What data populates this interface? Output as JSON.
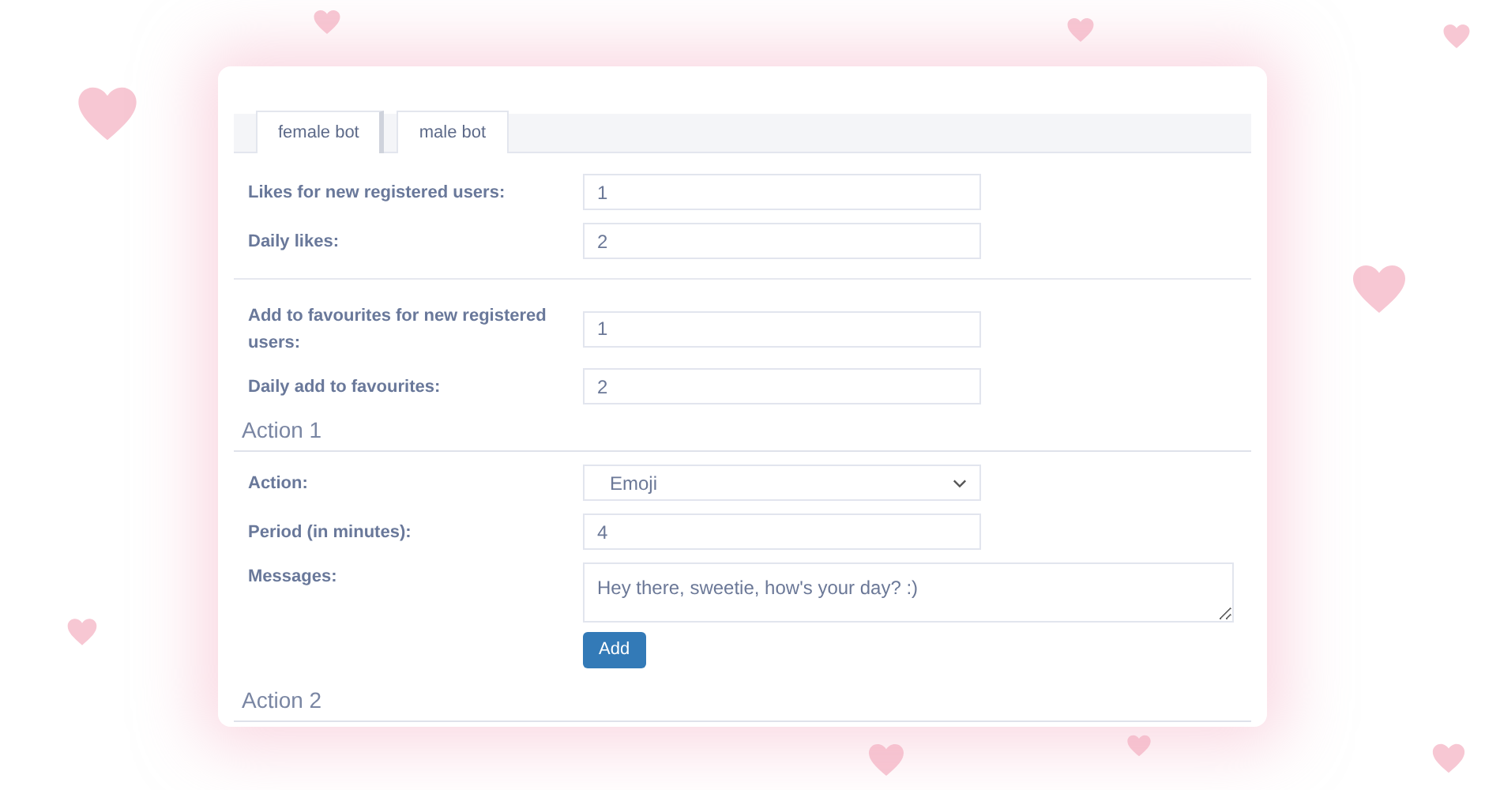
{
  "tabs": [
    {
      "label": "female bot",
      "selected": true
    },
    {
      "label": "male bot",
      "selected": false
    }
  ],
  "groups": [
    {
      "fields": [
        {
          "kind": "input",
          "label": "Likes for new registered users:",
          "value": "1"
        },
        {
          "kind": "input",
          "label": "Daily likes:",
          "value": "2"
        }
      ]
    },
    {
      "fields": [
        {
          "kind": "input",
          "label": "Add to favourites for new registered users:",
          "value": "1"
        },
        {
          "kind": "input",
          "label": "Daily add to favourites:",
          "value": "2"
        }
      ]
    }
  ],
  "actions": [
    {
      "title": "Action 1",
      "fields": [
        {
          "kind": "select",
          "label": "Action:",
          "value": "Emoji"
        },
        {
          "kind": "input",
          "label": "Period (in minutes):",
          "value": "4"
        },
        {
          "kind": "textarea",
          "label": "Messages:",
          "value": "Hey there, sweetie, how's your day? :)"
        }
      ],
      "button": "Add"
    },
    {
      "title": "Action 2",
      "fields": [
        {
          "kind": "cut"
        }
      ]
    }
  ]
}
